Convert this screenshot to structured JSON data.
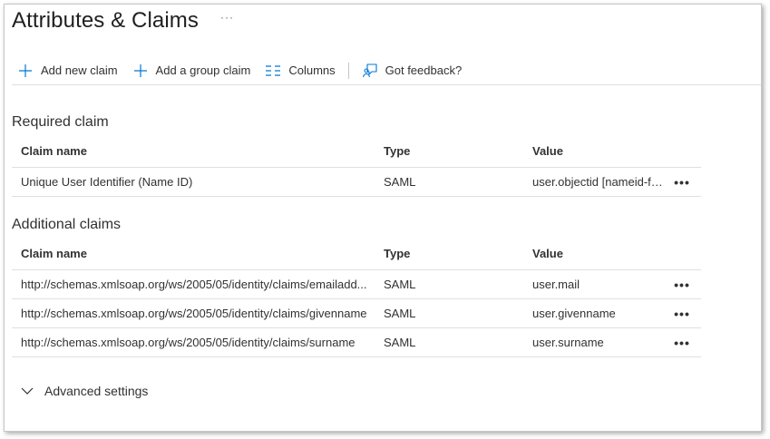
{
  "header": {
    "title": "Attributes & Claims",
    "more": "···"
  },
  "toolbar": {
    "add_new_claim": "Add new claim",
    "add_group_claim": "Add a group claim",
    "columns": "Columns",
    "feedback": "Got feedback?"
  },
  "required": {
    "title": "Required claim",
    "columns": {
      "name": "Claim name",
      "type": "Type",
      "value": "Value"
    },
    "rows": [
      {
        "name": "Unique User Identifier (Name ID)",
        "type": "SAML",
        "value": "user.objectid [nameid-fo...",
        "more": "•••"
      }
    ]
  },
  "additional": {
    "title": "Additional claims",
    "columns": {
      "name": "Claim name",
      "type": "Type",
      "value": "Value"
    },
    "rows": [
      {
        "name": "http://schemas.xmlsoap.org/ws/2005/05/identity/claims/emailadd...",
        "type": "SAML",
        "value": "user.mail",
        "more": "•••"
      },
      {
        "name": "http://schemas.xmlsoap.org/ws/2005/05/identity/claims/givenname",
        "type": "SAML",
        "value": "user.givenname",
        "more": "•••"
      },
      {
        "name": "http://schemas.xmlsoap.org/ws/2005/05/identity/claims/surname",
        "type": "SAML",
        "value": "user.surname",
        "more": "•••"
      }
    ]
  },
  "advanced": {
    "label": "Advanced settings"
  },
  "colors": {
    "accent": "#0078d4",
    "border": "#e1dfdd",
    "text": "#323130"
  },
  "icons": [
    "plus-icon",
    "columns-icon",
    "feedback-icon",
    "chevron-down-icon"
  ]
}
